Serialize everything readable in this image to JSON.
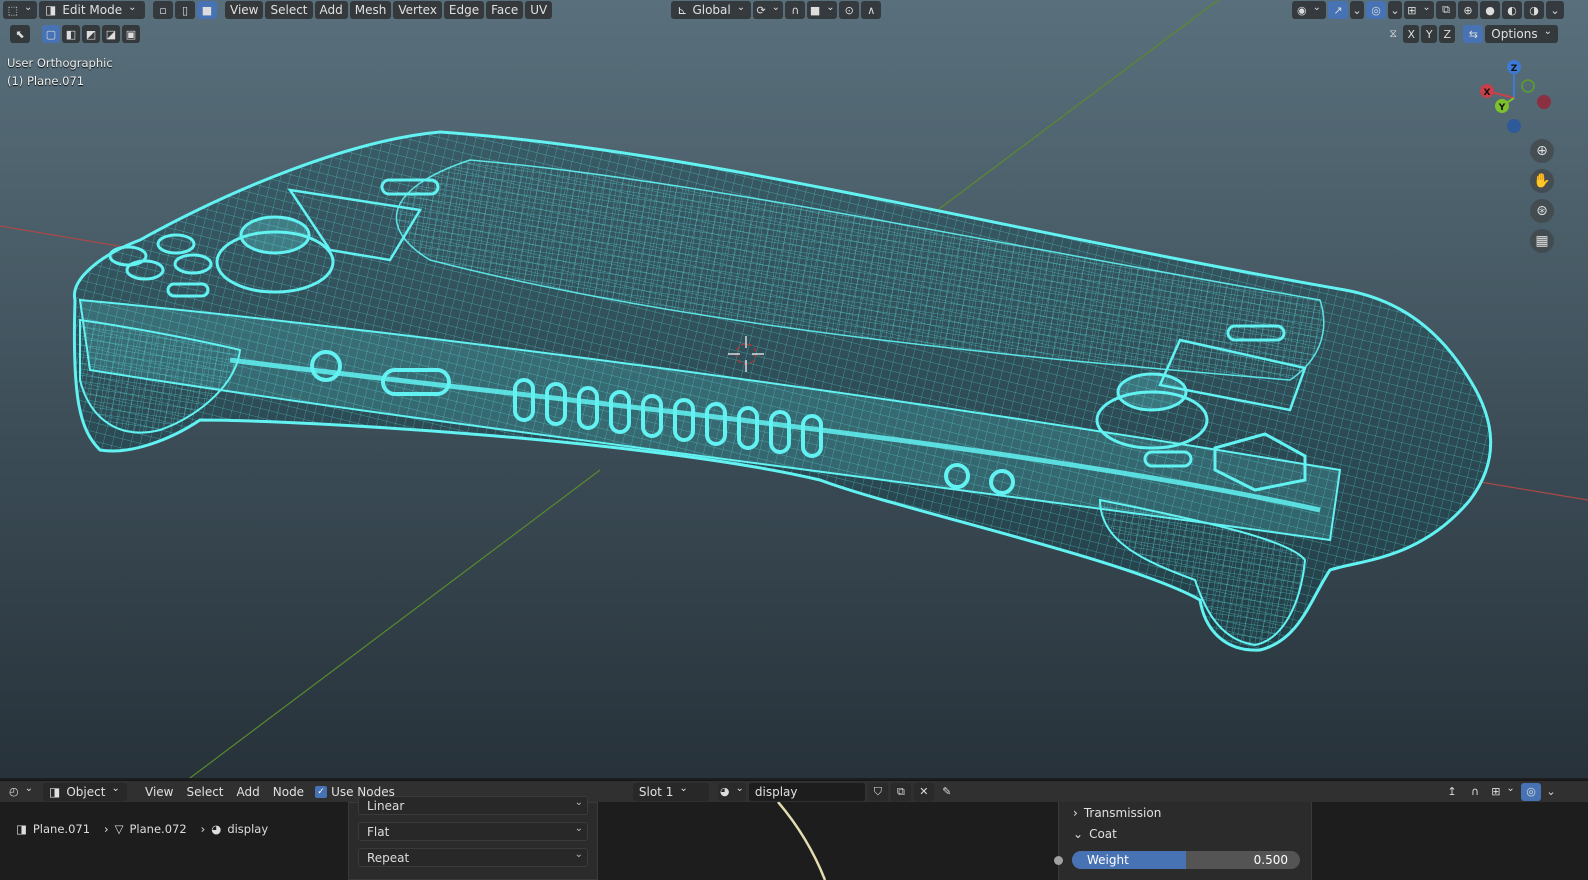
{
  "viewport": {
    "header": {
      "mode_label": "Edit Mode",
      "menus": [
        "View",
        "Select",
        "Add",
        "Mesh",
        "Vertex",
        "Edge",
        "Face",
        "UV"
      ],
      "transform_orientation": "Global",
      "options_label": "Options",
      "axis_buttons": [
        "X",
        "Y",
        "Z"
      ]
    },
    "overlay": {
      "view_name": "User Orthographic",
      "object_name": "(1) Plane.071"
    },
    "gizmo": {
      "x": "X",
      "y": "Y",
      "z": "Z"
    },
    "colors": {
      "wire": "#62f2f2",
      "x_axis": "#b44a4a",
      "y_axis": "#5c8a2e"
    }
  },
  "node_editor": {
    "header": {
      "object_label": "Object",
      "menus": [
        "View",
        "Select",
        "Add",
        "Node"
      ],
      "use_nodes_label": "Use Nodes",
      "use_nodes_checked": true,
      "slot_label": "Slot 1",
      "material_name": "display"
    },
    "breadcrumb": {
      "object": "Plane.071",
      "mesh": "Plane.072",
      "material": "display"
    },
    "dropdowns": [
      "Linear",
      "Flat",
      "Repeat"
    ],
    "properties": {
      "transmission_label": "Transmission",
      "coat_label": "Coat",
      "weight_label": "Weight",
      "weight_value": "0.500",
      "weight_fraction": 0.5
    }
  }
}
